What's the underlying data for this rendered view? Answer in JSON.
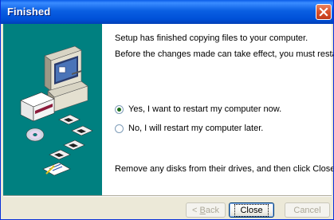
{
  "window": {
    "title": "Finished"
  },
  "content": {
    "line1": "Setup has finished copying files to your computer.",
    "line2": "Before the changes made can take effect, you must restart Windows.",
    "radio_yes": "Yes, I want to restart my computer now.",
    "radio_no": "No, I will restart my computer later.",
    "line3": "Remove any disks from their drives, and then click Close to complete setup.",
    "selected_option": "yes"
  },
  "buttons": {
    "back_label_underlined": "B",
    "back_label_rest": "ack",
    "back_prefix": "< ",
    "close_label": "Close",
    "cancel_label": "Cancel"
  },
  "colors": {
    "side_panel": "#008080",
    "titlebar": "#0054e3",
    "dialog_bg": "#ece9d8"
  },
  "icons": [
    "close-icon",
    "computer-illustration",
    "disk-icons",
    "cd-icon"
  ]
}
